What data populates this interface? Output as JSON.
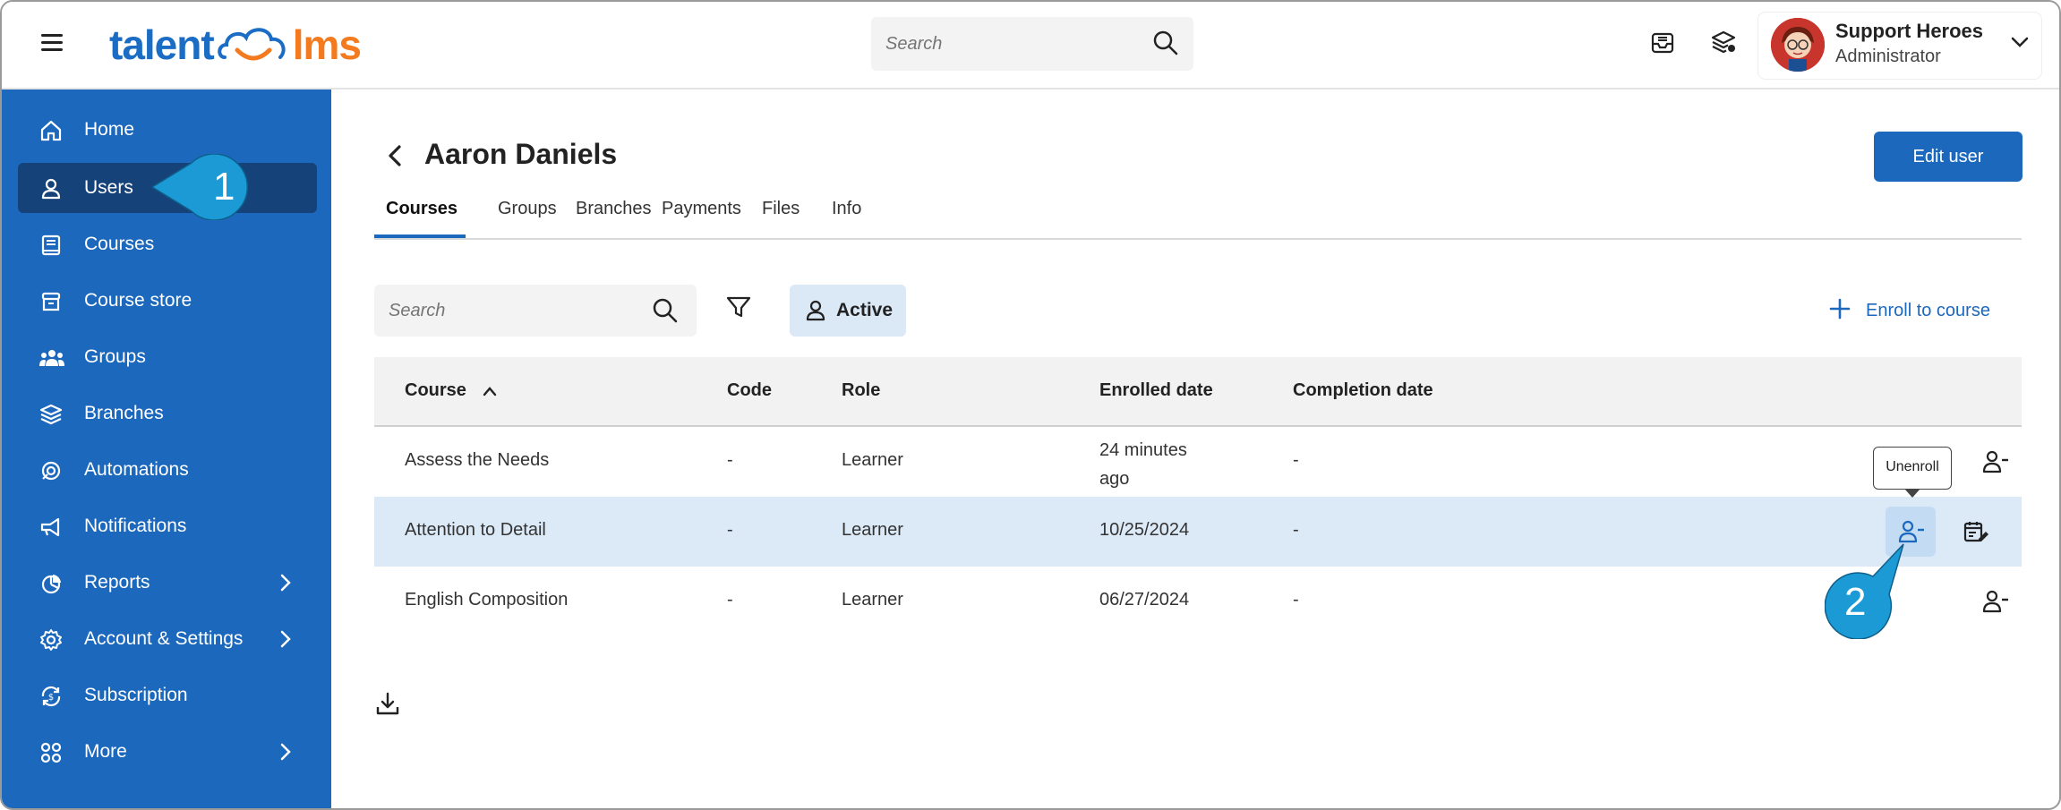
{
  "app": {
    "logo_left": "talent",
    "logo_right": "lms"
  },
  "top_search": {
    "placeholder": "Search"
  },
  "user": {
    "name": "Support Heroes",
    "role": "Administrator"
  },
  "sidebar": {
    "items": [
      {
        "label": "Home",
        "icon": "home-icon"
      },
      {
        "label": "Users",
        "icon": "user-icon",
        "active": true
      },
      {
        "label": "Courses",
        "icon": "book-icon"
      },
      {
        "label": "Course store",
        "icon": "store-icon"
      },
      {
        "label": "Groups",
        "icon": "groups-icon"
      },
      {
        "label": "Branches",
        "icon": "layers-icon"
      },
      {
        "label": "Automations",
        "icon": "automation-icon"
      },
      {
        "label": "Notifications",
        "icon": "megaphone-icon"
      },
      {
        "label": "Reports",
        "icon": "pie-chart-icon",
        "has_submenu": true
      },
      {
        "label": "Account & Settings",
        "icon": "gear-icon",
        "has_submenu": true
      },
      {
        "label": "Subscription",
        "icon": "subscription-icon"
      },
      {
        "label": "More",
        "icon": "grid-icon",
        "has_submenu": true
      }
    ]
  },
  "page": {
    "title": "Aaron Daniels",
    "edit_button": "Edit user",
    "tabs": [
      "Courses",
      "Groups",
      "Branches",
      "Payments",
      "Files",
      "Info"
    ],
    "active_tab": "Courses"
  },
  "toolbar": {
    "search_placeholder": "Search",
    "status_filter": "Active",
    "enroll_label": "Enroll to course"
  },
  "table": {
    "columns": [
      "Course",
      "Code",
      "Role",
      "Enrolled date",
      "Completion date"
    ],
    "sort_column": "Course",
    "sort_direction": "ascending",
    "rows": [
      {
        "course": "Assess the Needs",
        "code": "-",
        "role": "Learner",
        "enrolled_line1": "24 minutes",
        "enrolled_line2": "ago",
        "completion": "-"
      },
      {
        "course": "Attention to Detail",
        "code": "-",
        "role": "Learner",
        "enrolled": "10/25/2024",
        "completion": "-",
        "highlighted": true
      },
      {
        "course": "English Composition",
        "code": "-",
        "role": "Learner",
        "enrolled": "06/27/2024",
        "completion": "-"
      }
    ]
  },
  "tooltip": {
    "text": "Unenroll"
  },
  "callouts": {
    "step1": "1",
    "step2": "2"
  },
  "colors": {
    "sidebar": "#1b68bd",
    "sidebar_active": "#16427a",
    "accent": "#1b68bd",
    "logo_orange": "#f47a20",
    "callout": "#1b9ad6",
    "row_highlight": "#dceaf8"
  }
}
